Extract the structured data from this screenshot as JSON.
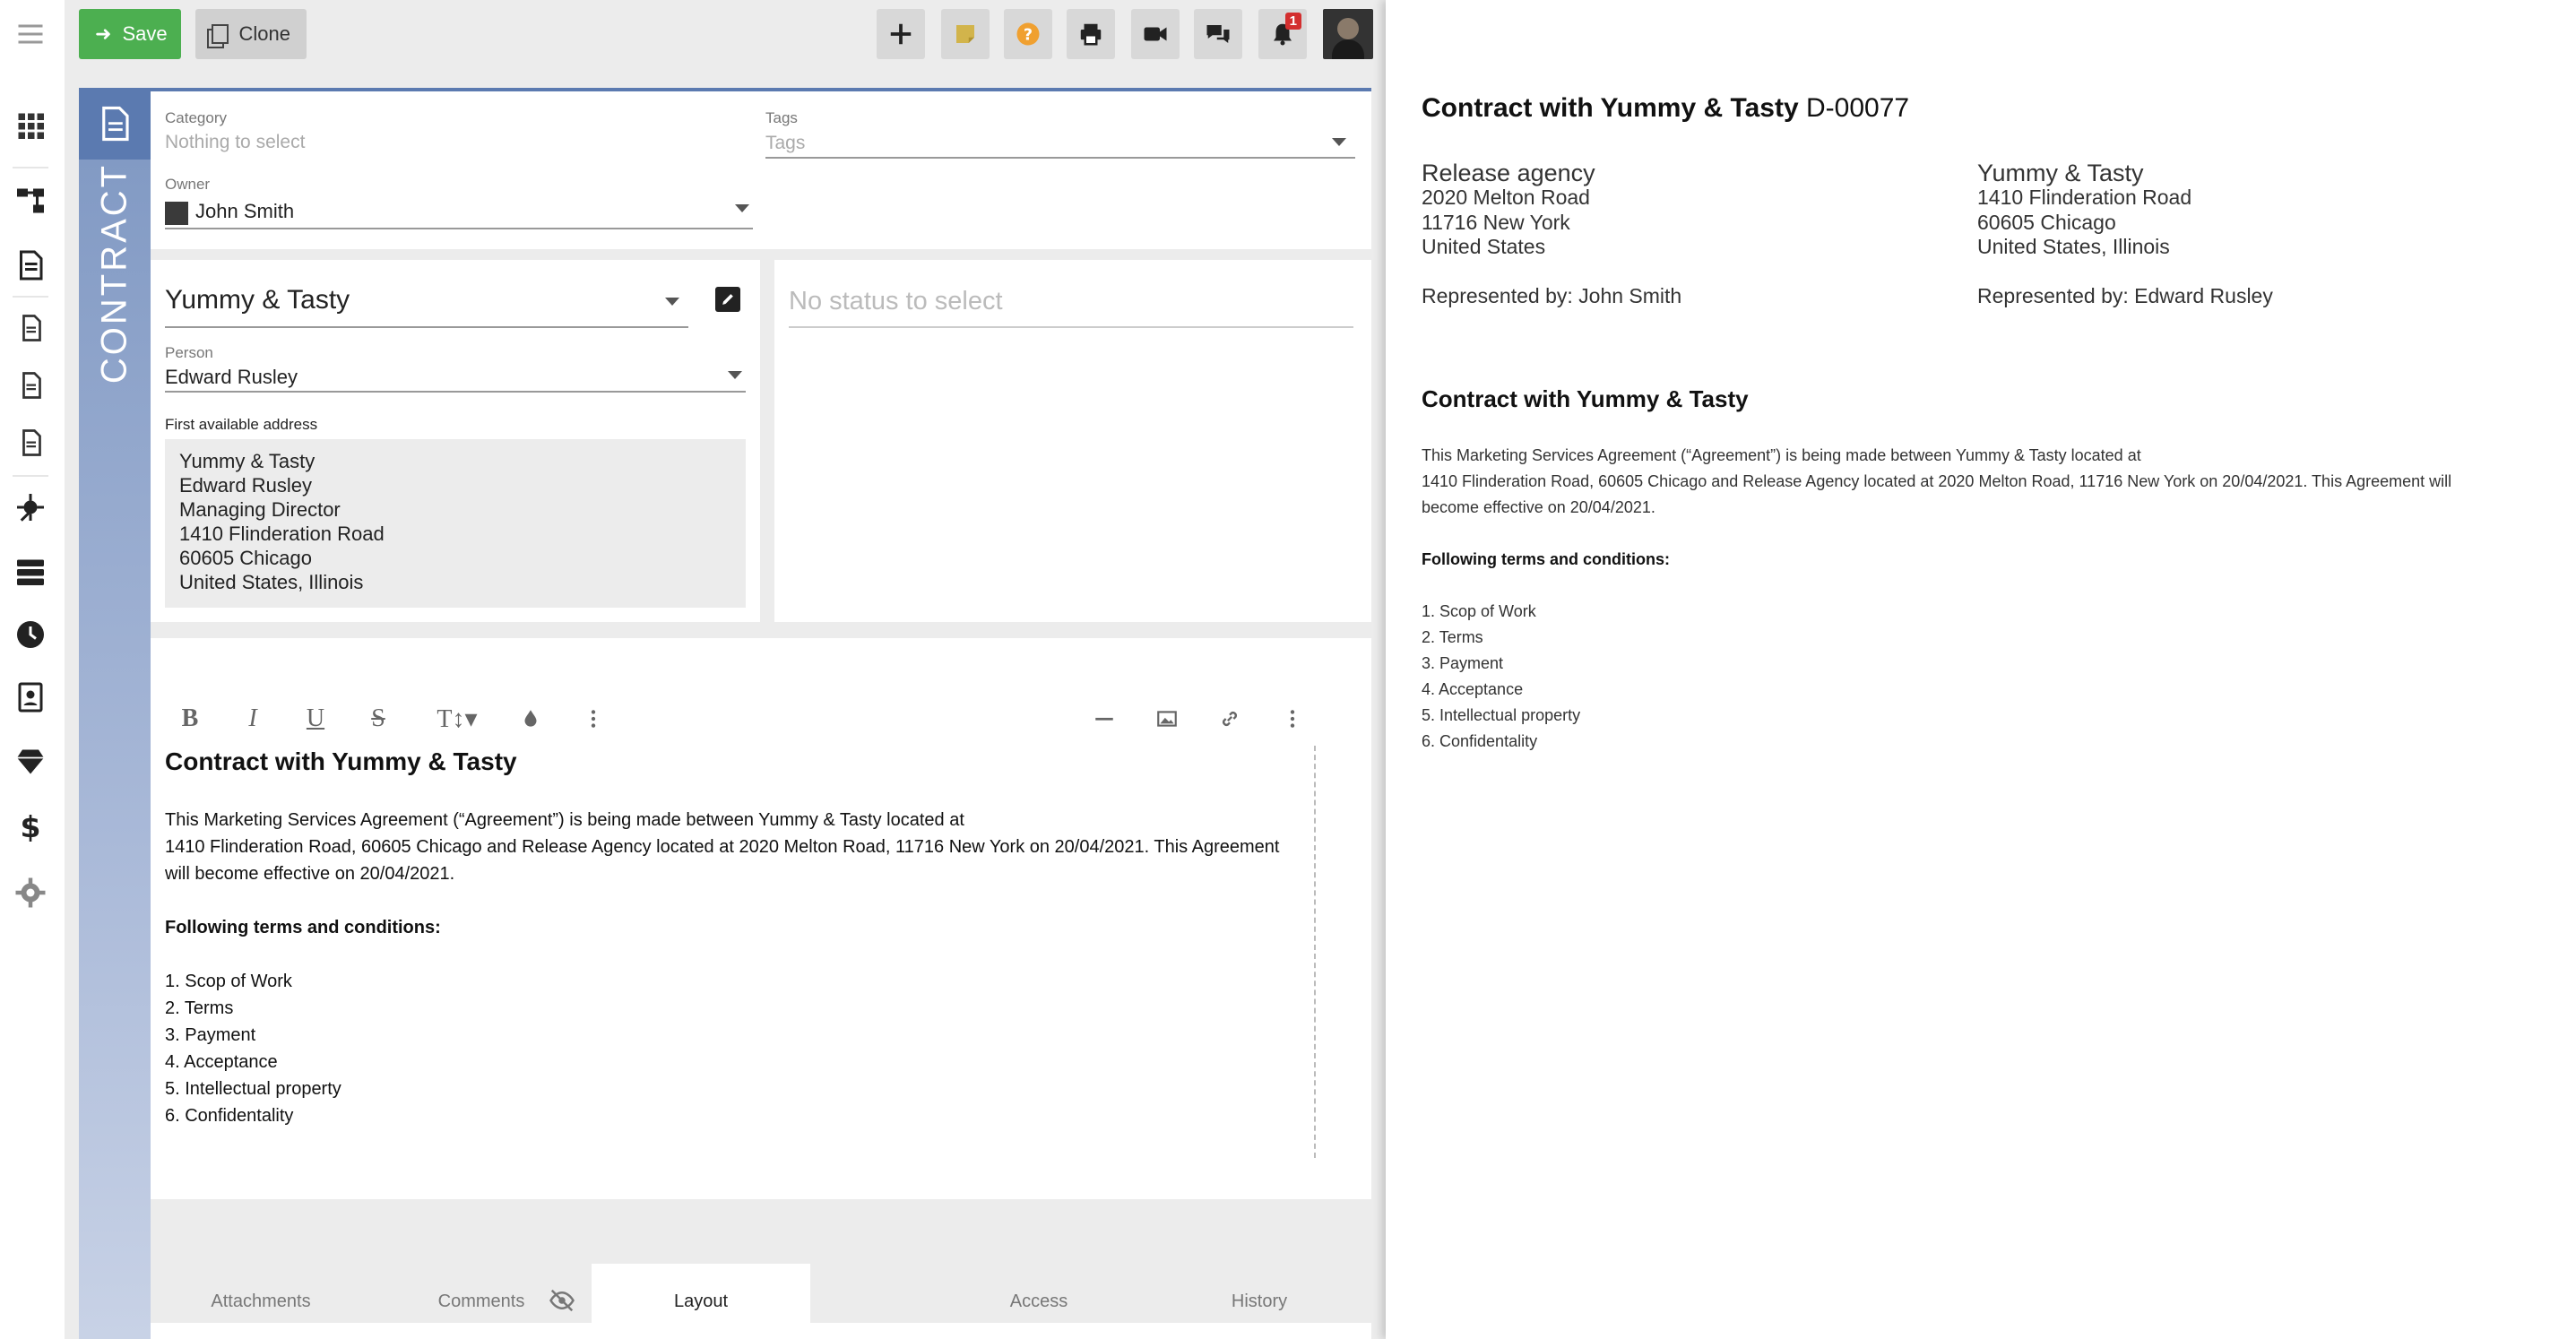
{
  "toolbar": {
    "save_label": "Save",
    "clone_label": "Clone",
    "notification_count": "1"
  },
  "strip": {
    "label": "CONTRACT"
  },
  "form": {
    "category": {
      "label": "Category",
      "placeholder": "Nothing to select"
    },
    "tags": {
      "label": "Tags",
      "placeholder": "Tags"
    },
    "owner": {
      "label": "Owner",
      "value": "John Smith"
    },
    "company": {
      "value": "Yummy & Tasty"
    },
    "person": {
      "label": "Person",
      "value": "Edward Rusley"
    },
    "address": {
      "label": "First available address",
      "lines": [
        "Yummy & Tasty",
        "Edward Rusley",
        "Managing Director",
        "1410 Flinderation Road",
        "60605 Chicago",
        "United States, Illinois"
      ]
    },
    "status": {
      "placeholder": "No status to select"
    }
  },
  "editor": {
    "title": "Contract with Yummy & Tasty",
    "para_lines": [
      "This Marketing Services Agreement (“Agreement”) is being made between Yummy & Tasty located at",
      "1410 Flinderation Road, 60605 Chicago and Release Agency located at 2020 Melton Road,  11716 New York on 20/04/2021. This Agreement",
      "will become effective on 20/04/2021."
    ],
    "terms_heading": "Following terms and conditions:",
    "terms": [
      "1. Scop of Work",
      "2. Terms",
      "3. Payment",
      "4. Acceptance",
      "5. Intellectual property",
      "6. Confidentality"
    ]
  },
  "tabs": [
    {
      "label": "Attachments"
    },
    {
      "label": "Comments"
    },
    {
      "label": "Layout"
    },
    {
      "label": "Access"
    },
    {
      "label": "History"
    }
  ],
  "preview": {
    "title": "Contract with Yummy & Tasty",
    "doc_number": "D-00077",
    "left_party": {
      "name": "Release agency",
      "lines": [
        "2020 Melton Road",
        "11716 New York",
        "United States"
      ],
      "represented": "Represented by: John Smith"
    },
    "right_party": {
      "name": "Yummy & Tasty",
      "lines": [
        "1410 Flinderation Road",
        "60605 Chicago",
        "United States, Illinois"
      ],
      "represented": "Represented by: Edward Rusley"
    },
    "body_title": "Contract with Yummy & Tasty",
    "para_lines": [
      "This Marketing Services Agreement (“Agreement”) is being made between Yummy & Tasty located at",
      "1410 Flinderation Road, 60605 Chicago and Release Agency located at 2020 Melton Road,  11716 New York on 20/04/2021. This Agreement will",
      "become effective on 20/04/2021."
    ],
    "terms_heading": "Following terms and conditions:",
    "terms": [
      "1. Scop of Work",
      "2. Terms",
      "3. Payment",
      "4. Acceptance",
      "5. Intellectual property",
      "6. Confidentality"
    ]
  },
  "colors": {
    "save_green": "#4caf50",
    "strip_blue": "#7e97c2",
    "note_yellow": "#d2b44b",
    "help_orange": "#f0a030",
    "badge_red": "#d32f2f"
  }
}
